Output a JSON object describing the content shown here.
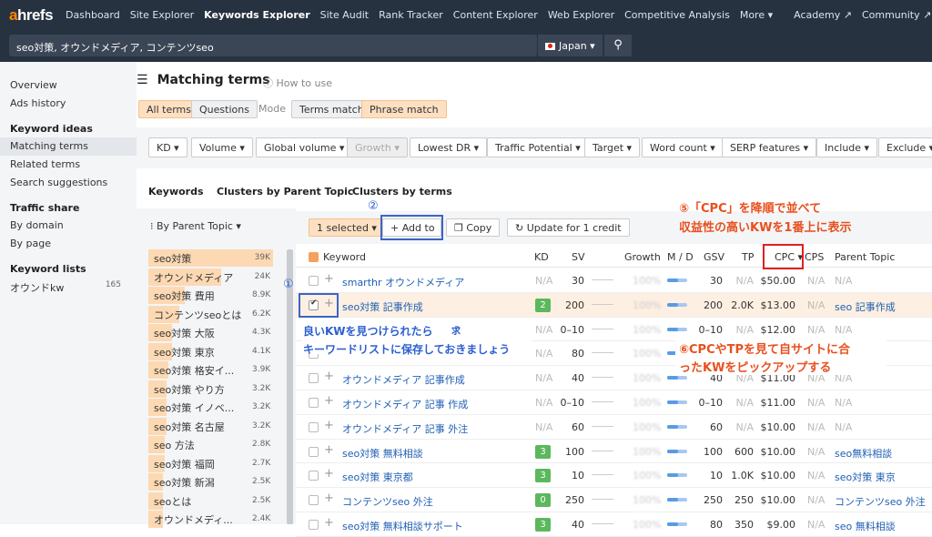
{
  "nav": {
    "logo_a": "a",
    "logo_rest": "hrefs",
    "items": [
      "Dashboard",
      "Site Explorer",
      "Keywords Explorer",
      "Site Audit",
      "Rank Tracker",
      "Content Explorer",
      "Web Explorer",
      "Competitive Analysis",
      "More ▾"
    ],
    "right_items": [
      "Academy ↗",
      "Community ↗"
    ]
  },
  "search": {
    "value": "seo対策, オウンドメディア, コンテンツseo",
    "country": "Japan ▾",
    "search_icon": "⚲"
  },
  "sidebar": {
    "items_top": [
      "Overview",
      "Ads history"
    ],
    "keyword_ideas_head": "Keyword ideas",
    "keyword_ideas": [
      "Matching terms",
      "Related terms",
      "Search suggestions"
    ],
    "traffic_head": "Traffic share",
    "traffic": [
      "By domain",
      "By page"
    ],
    "lists_head": "Keyword lists",
    "list_name": "オウンドkw",
    "list_count": "165"
  },
  "main": {
    "title": "Matching terms",
    "howto": "How to use",
    "tabs_terms": [
      "All terms",
      "Questions"
    ],
    "mode_label": "Mode",
    "match_modes": [
      "Terms match",
      "Phrase match"
    ],
    "filters": [
      "KD ▾",
      "Volume ▾",
      "Global volume ▾",
      "Growth ▾",
      "Lowest DR ▾",
      "Traffic Potential ▾",
      "Target ▾",
      "Word count ▾",
      "SERP features ▾",
      "Include ▾",
      "Exclude ▾"
    ],
    "result_tabs": [
      "Keywords",
      "Clusters by Parent Topic",
      "Clusters by terms"
    ],
    "group_by": "By Parent Topic ▾",
    "selected": "1 selected ▾",
    "add_to": "+ Add to",
    "copy": "Copy",
    "update": "Update for 1 credit"
  },
  "groups": [
    {
      "name": "seo対策",
      "count": "39K"
    },
    {
      "name": "オウンドメディア",
      "count": "24K"
    },
    {
      "name": "seo対策 費用",
      "count": "8.9K"
    },
    {
      "name": "コンテンツseoとは",
      "count": "6.2K"
    },
    {
      "name": "seo対策 大阪",
      "count": "4.3K"
    },
    {
      "name": "seo対策 東京",
      "count": "4.1K"
    },
    {
      "name": "seo対策 格安イ...",
      "count": "3.9K"
    },
    {
      "name": "seo対策 やり方",
      "count": "3.2K"
    },
    {
      "name": "seo対策 イノベ...",
      "count": "3.2K"
    },
    {
      "name": "seo対策 名古屋",
      "count": "3.2K"
    },
    {
      "name": "seo 方法",
      "count": "2.8K"
    },
    {
      "name": "seo対策 福岡",
      "count": "2.7K"
    },
    {
      "name": "seo対策 新潟",
      "count": "2.5K"
    },
    {
      "name": "seoとは",
      "count": "2.5K"
    },
    {
      "name": "オウンドメディ...",
      "count": "2.4K"
    }
  ],
  "table": {
    "headers": [
      "Keyword",
      "KD",
      "SV",
      "Growth",
      "M / D",
      "GSV",
      "TP",
      "CPC ▾",
      "CPS",
      "Parent Topic"
    ],
    "rows": [
      {
        "kw": "smarthr オウンドメディア",
        "kd": "N/A",
        "sv": "30",
        "gsv": "30",
        "tp": "N/A",
        "cpc": "$50.00",
        "cps": "N/A",
        "pt": "N/A",
        "sel": false
      },
      {
        "kw": "seo対策 記事作成",
        "kd": "2",
        "sv": "200",
        "gsv": "200",
        "tp": "2.0K",
        "cpc": "$13.00",
        "cps": "N/A",
        "pt": "seo 記事作成",
        "sel": true
      },
      {
        "kw": "",
        "kd": "N/A",
        "sv": "0–10",
        "gsv": "0–10",
        "tp": "N/A",
        "cpc": "$12.00",
        "cps": "N/A",
        "pt": "N/A",
        "sel": false
      },
      {
        "kw": "",
        "kd": "N/A",
        "sv": "80",
        "gsv": "",
        "tp": "",
        "cpc": "",
        "cps": "",
        "pt": "",
        "sel": false
      },
      {
        "kw": "オウンドメディア 記事作成",
        "kd": "N/A",
        "sv": "40",
        "gsv": "40",
        "tp": "N/A",
        "cpc": "$11.00",
        "cps": "N/A",
        "pt": "N/A",
        "sel": false
      },
      {
        "kw": "オウンドメディア 記事 作成",
        "kd": "N/A",
        "sv": "0–10",
        "gsv": "0–10",
        "tp": "N/A",
        "cpc": "$11.00",
        "cps": "N/A",
        "pt": "N/A",
        "sel": false
      },
      {
        "kw": "オウンドメディア 記事 外注",
        "kd": "N/A",
        "sv": "60",
        "gsv": "60",
        "tp": "N/A",
        "cpc": "$10.00",
        "cps": "N/A",
        "pt": "N/A",
        "sel": false
      },
      {
        "kw": "seo対策 無料相談",
        "kd": "3",
        "sv": "100",
        "gsv": "100",
        "tp": "600",
        "cpc": "$10.00",
        "cps": "N/A",
        "pt": "seo無料相談",
        "sel": false
      },
      {
        "kw": "seo対策 東京都",
        "kd": "3",
        "sv": "10",
        "gsv": "10",
        "tp": "1.0K",
        "cpc": "$10.00",
        "cps": "N/A",
        "pt": "seo対策 東京",
        "sel": false
      },
      {
        "kw": "コンテンツseo 外注",
        "kd": "0",
        "sv": "250",
        "gsv": "250",
        "tp": "250",
        "cpc": "$10.00",
        "cps": "N/A",
        "pt": "コンテンツseo 外注",
        "sel": false
      },
      {
        "kw": "seo対策 無料相談サポート",
        "kd": "3",
        "sv": "40",
        "gsv": "80",
        "tp": "350",
        "cpc": "$9.00",
        "cps": "N/A",
        "pt": "seo 無料相談",
        "sel": false
      }
    ],
    "growth_text": "100%"
  },
  "annotations": {
    "circle1": "①",
    "circle2": "②",
    "note5_line1": "⑤「CPC」を降順で並べて",
    "note5_line2": "収益性の高いKWを1番上に表示",
    "note1_line1": "良いKWを見つけられたら",
    "note1_line2": "キーワードリストに保存しておきましょう",
    "note6_line1": "⑥CPCやTPを見て自サイトに合",
    "note6_line2": "ったKWをピックアップする",
    "partial_text": "求"
  },
  "colors": {
    "nav_bg": "#273241",
    "accent_orange": "#ff8800",
    "link_blue": "#1f5fb3",
    "annotation_red": "#e02020",
    "annotation_blue": "#3b64c8"
  }
}
